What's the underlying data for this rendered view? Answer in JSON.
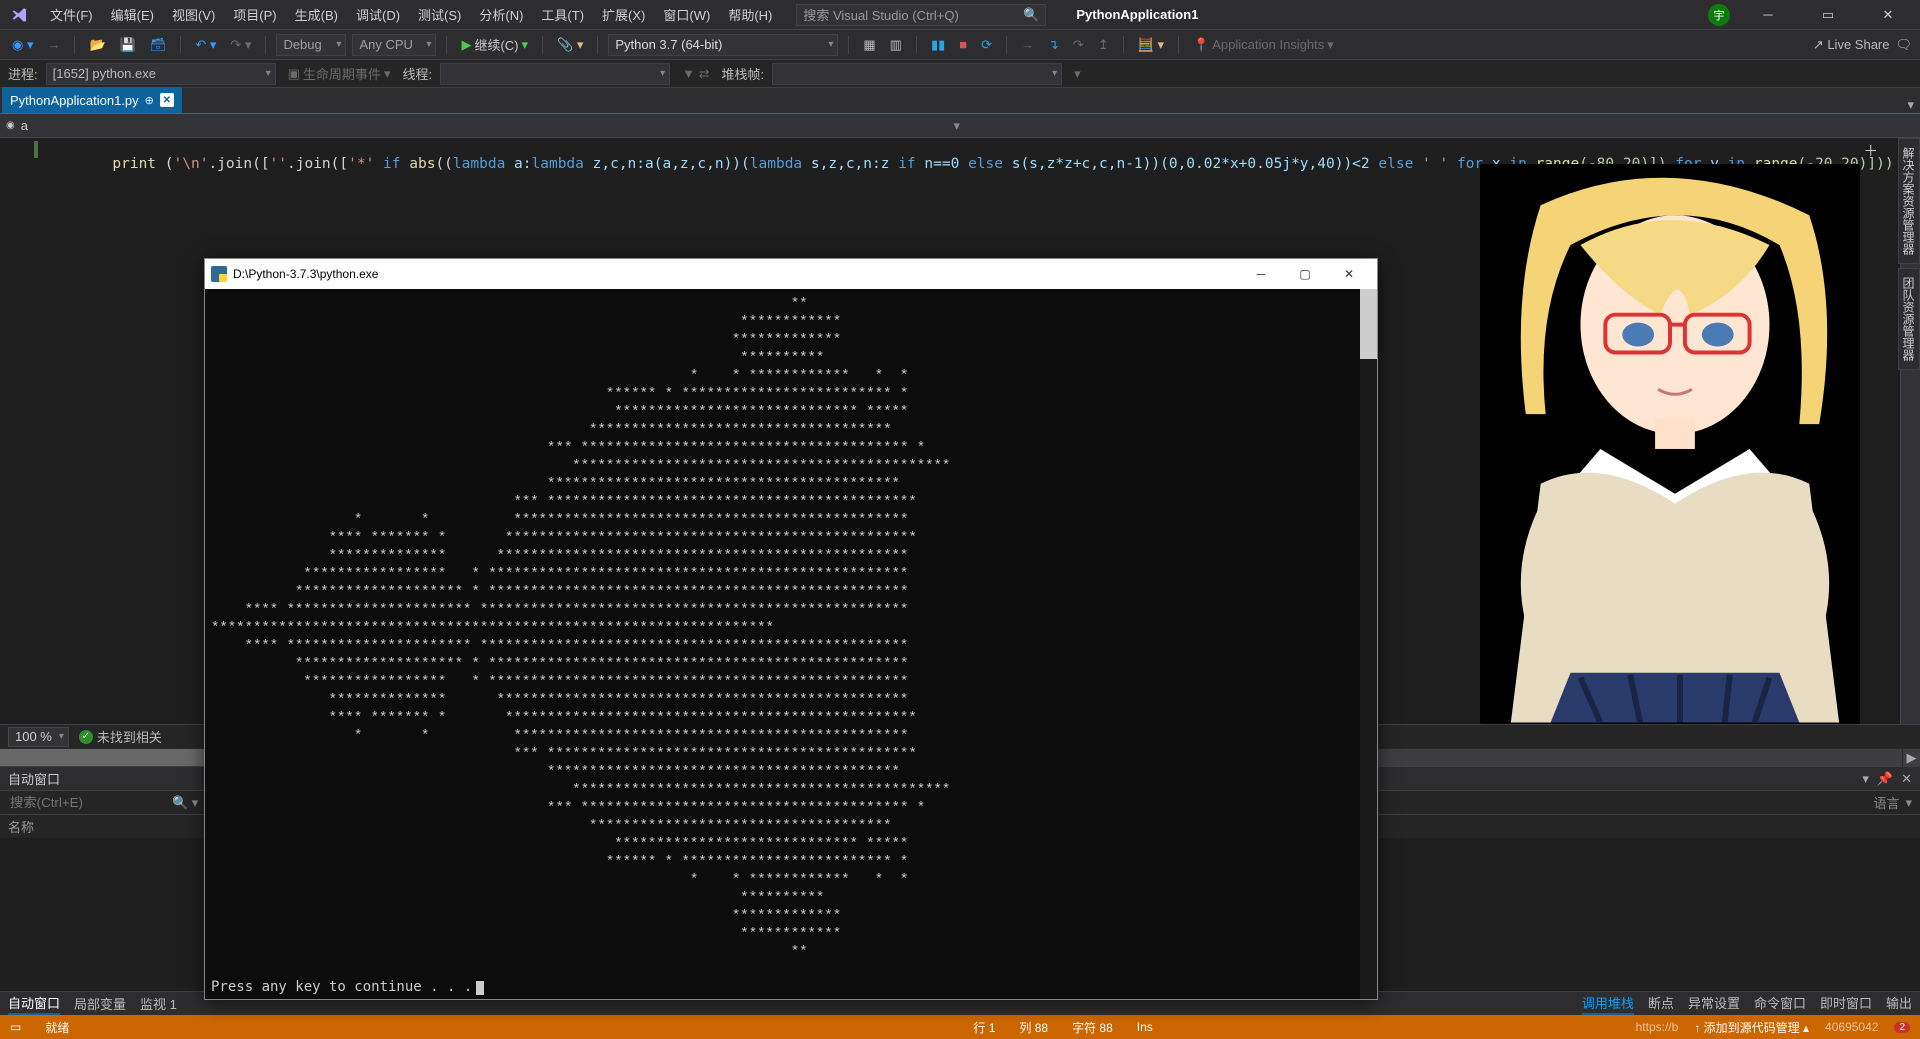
{
  "menu": {
    "file": "文件(F)",
    "edit": "编辑(E)",
    "view": "视图(V)",
    "project": "项目(P)",
    "build": "生成(B)",
    "debug": "调试(D)",
    "test": "测试(S)",
    "analyze": "分析(N)",
    "tools": "工具(T)",
    "extensions": "扩展(X)",
    "window": "窗口(W)",
    "help": "帮助(H)"
  },
  "search_placeholder": "搜索 Visual Studio (Ctrl+Q)",
  "app_title": "PythonApplication1",
  "avatar": "宇",
  "toolbar": {
    "config": "Debug",
    "platform": "Any CPU",
    "continue": "继续(C)",
    "interpreter": "Python 3.7 (64-bit)",
    "insights": "Application Insights",
    "liveshare": "Live Share"
  },
  "toolbar2": {
    "proc_label": "进程:",
    "proc_value": "[1652] python.exe",
    "life": "生命周期事件",
    "thread": "线程:",
    "stackframe": "堆栈帧:"
  },
  "tab_name": "PythonApplication1.py",
  "crumb": "a",
  "code": {
    "print": "print",
    "open": " (",
    "str1": "'\\n'",
    "join": ".join([",
    "str2": "''",
    "join2": ".join([",
    "str3": "'*'",
    "if": " if ",
    "abs": "abs",
    "open2": "((",
    "lam1": "lambda",
    "args1": " a:",
    "lam2": "lambda",
    "args2": " z,c,n:a(a,z,c,n))(",
    "lam3": "lambda",
    "args3": " s,z,c,n:z ",
    "if2": "if",
    "cond": " n==0 ",
    "else": "else",
    " call": " s(s,z*z+c,c,n-1))(0,0.02*x+0.05j*y,40))<2 ",
    "else2": "else",
    "sp": " ",
    "str4": "' '",
    "for1": " for",
    "x": " x ",
    "in1": "in ",
    "range1": "range",
    "r1": "(-80,20)]) ",
    "for2": "for",
    "y": " y ",
    "in2": "in ",
    "range2": "range",
    "r2": "(-20,20)]))"
  },
  "console": {
    "title": "D:\\Python-3.7.3\\python.exe",
    "prompt": "Press any key to continue . . .",
    "art": "                                                                     **\n                                                               ************\n                                                              *************\n                                                               **********\n                                                         *    * ************   *  *\n                                               ****** * ************************* *\n                                                ***************************** *****\n                                             ************************************\n                                        *** *************************************** *\n                                           *********************************************\n                                        ******************************************\n                                    *** ********************************************\n                 *       *          ***********************************************\n              **** ******* *       *************************************************\n              **************      *************************************************\n           *****************   * **************************************************\n          ******************** * **************************************************\n    **** ********************** ***************************************************\n*******************************************************************\n    **** ********************** ***************************************************\n          ******************** * **************************************************\n           *****************   * **************************************************\n              **************      *************************************************\n              **** ******* *       *************************************************\n                 *       *          ***********************************************\n                                    *** ********************************************\n                                        ******************************************\n                                           *********************************************\n                                        *** *************************************** *\n                                             ************************************\n                                                ***************************** *****\n                                               ****** * ************************* *\n                                                         *    * ************   *  *\n                                                               **********\n                                                              *************\n                                                               ************\n                                                                     **"
  },
  "zoom": "100 %",
  "nofind": "未找到相关",
  "panels": {
    "auto": "自动窗口",
    "search_ph": "搜索(Ctrl+E)",
    "col_name": "名称",
    "lang": "语言"
  },
  "bottom_tabs": {
    "left": [
      "自动窗口",
      "局部变量",
      "监视 1"
    ],
    "right": [
      "调用堆栈",
      "断点",
      "异常设置",
      "命令窗口",
      "即时窗口",
      "输出"
    ]
  },
  "status": {
    "ready": "就绪",
    "line": "行 1",
    "col": "列 88",
    "char": "字符 88",
    "ins": "Ins",
    "src": "添加到源代码管理",
    "url": "https://b",
    "count": "40695042"
  },
  "side_tabs": [
    "解决方案资源管理器",
    "团队资源管理器"
  ]
}
